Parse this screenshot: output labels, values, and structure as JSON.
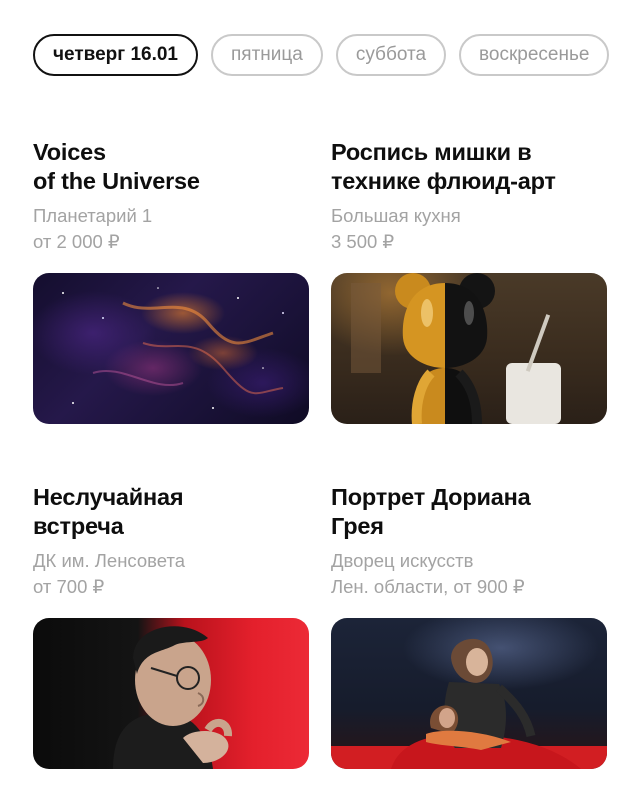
{
  "day_tabs": [
    {
      "label": "четверг 16.01",
      "active": true
    },
    {
      "label": "пятница",
      "active": false
    },
    {
      "label": "суббота",
      "active": false
    },
    {
      "label": "воскресенье",
      "active": false
    }
  ],
  "events": [
    {
      "title": "Voices\nof the Universe",
      "venue": "Планетарий 1",
      "price": "от 2 000 ₽",
      "image": "space-nebula-image"
    },
    {
      "title": "Роспись мишки в\nтехнике флюид-арт",
      "venue": "Большая кухня",
      "price": "3 500 ₽",
      "image": "painted-bear-figurine-image"
    },
    {
      "title": "Неслучайная\nвстреча",
      "venue": "ДК им. Ленсовета",
      "price": "от 700 ₽",
      "image": "man-with-glasses-portrait-image"
    },
    {
      "title": "Портрет Дориана\nГрея",
      "venue": "Дворец искусств",
      "price": "Лен. области, от 900 ₽",
      "image": "theatre-stage-image"
    }
  ],
  "colors": {
    "active_tab_border": "#111111",
    "inactive_tab_border": "#c9c9c9",
    "meta_text": "#a3a3a3",
    "accent_red": "#e4202c"
  }
}
